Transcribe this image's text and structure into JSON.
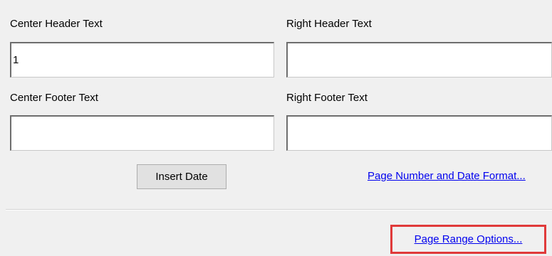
{
  "center_header": {
    "label": "Center Header Text",
    "value": "1"
  },
  "right_header": {
    "label": "Right Header Text",
    "value": ""
  },
  "center_footer": {
    "label": "Center Footer Text",
    "value": ""
  },
  "right_footer": {
    "label": "Right Footer Text",
    "value": ""
  },
  "insert_date_button": {
    "label": "Insert Date"
  },
  "links": {
    "page_number_date_format": "Page Number and Date Format...",
    "page_range_options": "Page Range Options..."
  },
  "colors": {
    "link": "#0000ee",
    "highlight_border": "#e03a3a",
    "background": "#f0f0f0"
  }
}
